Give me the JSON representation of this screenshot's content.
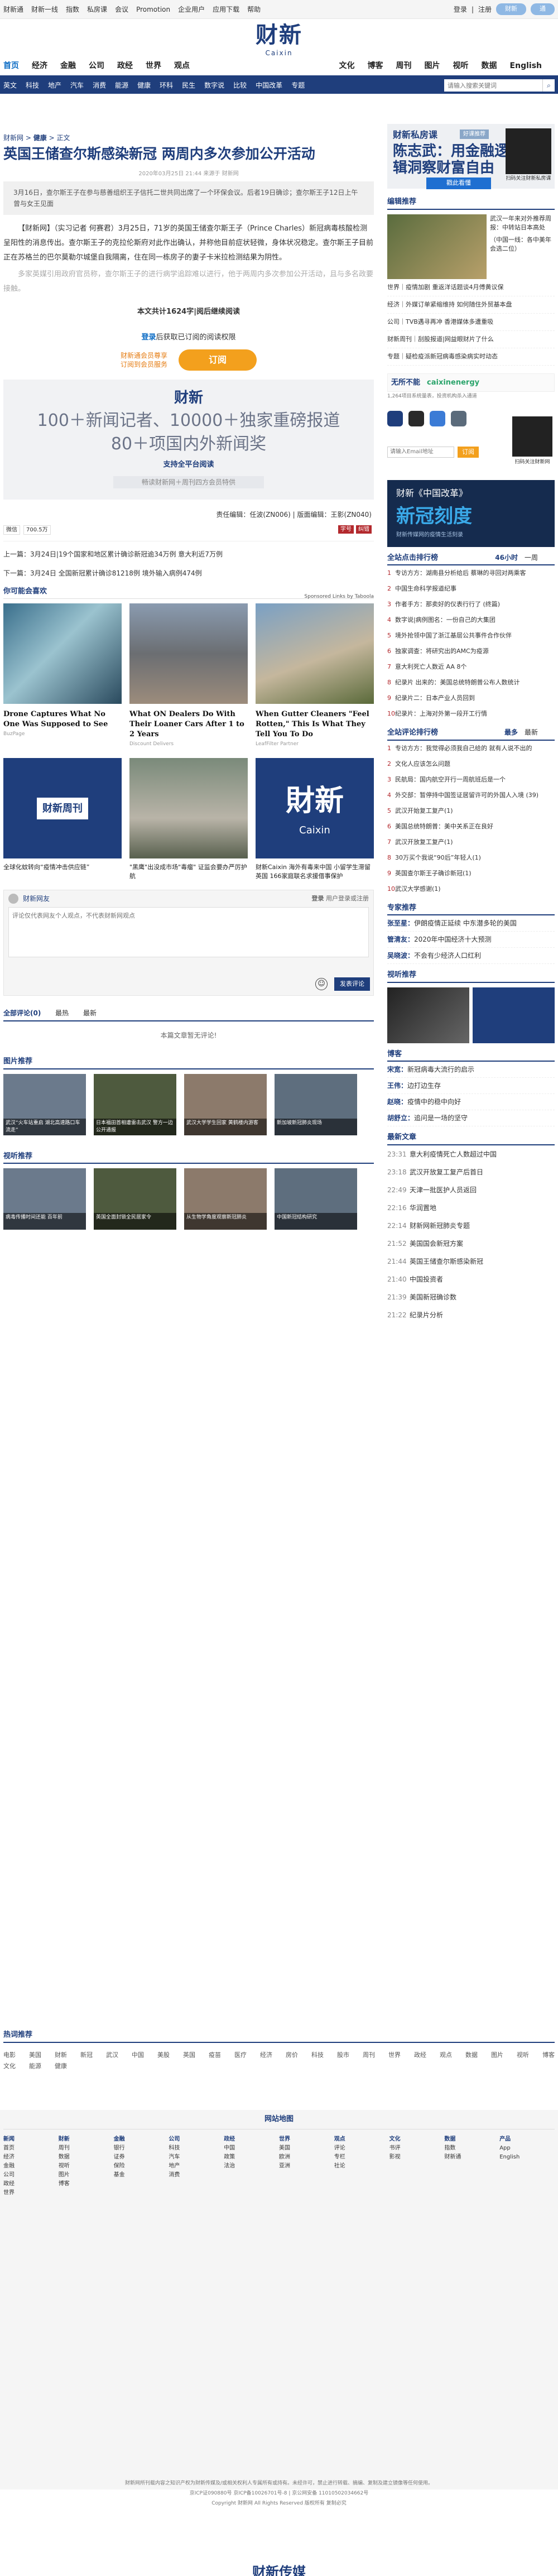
{
  "topbar": {
    "left": [
      "财新通",
      "财新一线",
      "指数",
      "私房课",
      "会议",
      "Promotion",
      "企业用户",
      "应用下载",
      "帮助"
    ],
    "login": "登录",
    "register": "注册",
    "btn1": "财新",
    "btn2": "通"
  },
  "logo": {
    "cn": "财新",
    "en": "Caixin"
  },
  "nav1": [
    "首页",
    "经济",
    "金融",
    "公司",
    "政经",
    "世界",
    "观点",
    "文化",
    "博客",
    "周刊",
    "图片",
    "视听",
    "数据",
    "English"
  ],
  "nav2": [
    "英文",
    "科技",
    "地产",
    "汽车",
    "消费",
    "能源",
    "健康",
    "环科",
    "民生",
    "数字说",
    "比较",
    "中国改革",
    "专题"
  ],
  "search_placeholder": "请输入搜索关键词",
  "breadcrumb": {
    "home": "财新网",
    "sep1": ">",
    "c1": "健康",
    "sep2": ">",
    "c2": "正文"
  },
  "title": "英国王储查尔斯感染新冠 两周内多次参加公开活动",
  "meta": "2020年03月25日 21:44 来源于 财新网",
  "summary": "3月16日，查尔斯王子在参与慈善组织王子信托二世共同出席了一个环保会议。后者19日确诊；查尔斯王子12日上午曾与女王见面",
  "paras": [
    "【财新网】（实习记者 何赛君）3月25日，71岁的英国王储查尔斯王子（Prince Charles）新冠病毒核酸检测呈阳性的消息传出。查尔斯王子的克拉伦斯府对此作出确认，并称他目前症状轻微，身体状况稳定。查尔斯王子目前正在苏格兰的巴尔莫勒尔城堡自我隔离，住在同一栋房子的妻子卡米拉检测结果为阴性。",
    "多家英媒引用政府官员称，查尔斯王子的进行病学追踪难以进行，他于两周内多次参加公开活动，且与多名政要接触。"
  ],
  "total": "本文共计1624字|阅后继续阅读",
  "login_line": {
    "a": "登录",
    "b": "后获取已订阅的阅读权限"
  },
  "subscribe": {
    "t1": "财新通会员尊享",
    "t2": "订阅到会员服务",
    "btn": "订阅"
  },
  "promo": {
    "logo": "财新",
    "l1": "100＋新闻记者、10000＋独家重磅报道",
    "l2": "80＋项国内外新闻奖",
    "l3": "支持全平台阅读",
    "l4": "畅读财新网＋周刊四方会员特供"
  },
  "editor": "责任编辑：任波(ZN006) | 版面编辑：王影(ZN040)",
  "share": [
    "微信",
    "700.5万"
  ],
  "corrections": [
    "字号",
    "纠错"
  ],
  "prev": "上一篇：3月24日|19个国家和地区累计确诊新冠逾34万例 意大利近7万例",
  "next": "下一篇：3月24日 全国新冠累计确诊81218例 境外输入病例474例",
  "maylike": "你可能会喜欢",
  "sponsored": "Sponsored Links by Taboola",
  "cards": [
    {
      "t": "Drone Captures What No One Was Supposed to See",
      "s": "BuzPage"
    },
    {
      "t": "What ON Dealers Do With Their Loaner Cars After 1 to 2 Years",
      "s": "Discount Delivers"
    },
    {
      "t": "When Gutter Cleaners \"Feel Rotten,\" This Is What They Tell You To Do",
      "s": "LeafFilter Partner"
    }
  ],
  "cards2": [
    {
      "t": "全球化蚊转向“疫情冲击供应链”"
    },
    {
      "t": "\"黑鹰\"出没成市场\"毒瘤\" 证监会要办严厉护航"
    },
    {
      "t": "财新Caixin 海外有毒来中国 小留学生滞留英国 166家庭联名求援借事保护"
    }
  ],
  "comment": {
    "user": "财新网友",
    "login": "登录",
    "reg": "用户登录或注册",
    "placeholder": "评论仅代表网友个人观点，不代表财新网观点",
    "send": "发表评论"
  },
  "ctabs": [
    "全部评论(0)",
    "最热",
    "最新"
  ],
  "nocomment": "本篇文章暂无评论!",
  "pic_h": "图片推荐",
  "pics": [
    "武汉“火车站重启 湖北高速路口车流走”",
    "日本福田首相遭雷击武汉 警方一边公开通报",
    "武汉大学学生回家 黄鹤楼内游客",
    "新加坡新冠肺炎现场"
  ],
  "video_h": "视听推荐",
  "vids": [
    "病毒传播时间还能 百年前",
    "英国全面封锁全民居家令",
    "从生物学角度观察新冠肺炎",
    "中国新冠结构研究"
  ],
  "ad1": {
    "t1": "财新私房课",
    "tag": "好课推荐",
    "t2a": "陈志武：用金融逻",
    "t2b": "辑洞察财富自由",
    "btn": "戳此看懂",
    "qr": "扫码关注财新私房课"
  },
  "rec_h": "编辑推荐",
  "rec_img": [
    "武汉一年来对外推荐周报：中转站日本高处",
    "（中国一线：各中美年会选二位）"
  ],
  "rec_list": [
    "世界｜疫情加剧 重返洋话题谈4月傅黄议保",
    "经济｜外媒订单紧缩维持 如何随住外贸基本盘",
    "公司｜TVB遇寻再冲 香港媒体多遭重吸",
    "财新周刊｜刮股报道|网益眼财片了什么",
    "专题｜疑检疫派新冠病毒感染病实时动态"
  ],
  "ad2": {
    "a": "无所不能",
    "b": "caixinenergy",
    "c": "1,264项目系统量表，投资机构杀入通道"
  },
  "app": {
    "label": "App",
    "mail": "请输入Email地址",
    "btn": "订阅",
    "qr": "扫码关注财新网"
  },
  "cover": {
    "a": "财新《中国改革》",
    "b": "新冠刻度",
    "c": "财新传媒网的疫情生活刻录"
  },
  "rank": {
    "title": "全站点击排行榜",
    "tab1": "46小时",
    "tab2": "一周",
    "items": [
      "专访方方：湖南县分析给后 蔡琳的寻回对两乘客",
      "中国生命科学报道纪事",
      "作者手方：那卖好的仪表行行了 (终篇)",
      "数字说|病例图名：一份自己的大集团",
      "境外抢领中国了浙江基层公共事件合作伙伴",
      "独家调查：将研究出的AMC为疫源",
      "意大利死亡人数近 AA 8个",
      "纪录片 出来的：美国总统特朗普公布人数统计",
      "纪录片二：日本产业人员回到",
      "纪录片：上海对外第一段开工行情"
    ]
  },
  "rank2": {
    "title": "全站评论排行榜",
    "tab1": "最多",
    "tab2": "最新",
    "items": [
      "专访方方：我觉得必须我自己给的 就有人说不出的",
      "文化人应该怎么问题",
      "民航局：国内航空开行一周航班后是一个",
      "外交部：暂停持中国签证居留许可的外国人入境 (39)",
      "武汉开始复工复产(1)",
      "美国总统特朗普：美中关系正在良好",
      "武汉开放复工复产(1)",
      "30万买个我说“90后”年轻人(1)",
      "英国查尔斯王子确诊新冠(1)",
      "武汉大学感谢(1)"
    ]
  },
  "blog_h": "博客",
  "expert_h": "专家推荐",
  "experts": [
    {
      "n": "张至星：",
      "t": "伊朗疫情正延续 中东潜多轮的美国"
    },
    {
      "n": "管清友：",
      "t": "2020年中国经济十大预测"
    },
    {
      "n": "吴晓波：",
      "t": "不会有少经济人口红利"
    }
  ],
  "blogs": [
    {
      "n": "宋宽：",
      "t": "新冠病毒大流行的启示"
    },
    {
      "n": "王伟：",
      "t": "边打边生存"
    },
    {
      "n": "赵晓：",
      "t": "疫情中的稳中向好"
    },
    {
      "n": "胡舒立：",
      "t": "追问是一场的坚守"
    }
  ],
  "news_h": "最新文章",
  "news": [
    {
      "tm": "23:31",
      "t": "意大利疫情死亡人数超过中国"
    },
    {
      "tm": "23:18",
      "t": "武汉开放复工复产后首日"
    },
    {
      "tm": "22:49",
      "t": "天津一批医护人员返回"
    },
    {
      "tm": "22:16",
      "t": "华润置地"
    },
    {
      "tm": "22:14",
      "t": "财新网新冠肺炎专题"
    },
    {
      "tm": "21:52",
      "t": "美国国会新冠方案"
    },
    {
      "tm": "21:44",
      "t": "英国王储查尔斯感染新冠"
    },
    {
      "tm": "21:40",
      "t": "中国投资者"
    },
    {
      "tm": "21:39",
      "t": "美国新冠确诊数"
    },
    {
      "tm": "21:22",
      "t": "纪录片分析"
    }
  ],
  "hot_h": "热词推荐",
  "hot": [
    "电影",
    "美国",
    "财新",
    "新冠",
    "武汉",
    "中国",
    "美股",
    "英国",
    "疫苗",
    "医疗",
    "经济",
    "房价",
    "科技",
    "股市",
    "周刊",
    "世界",
    "政经",
    "观点",
    "数据",
    "图片",
    "视听",
    "博客",
    "文化",
    "能源",
    "健康"
  ],
  "sitemap_h": "网站地图",
  "sitemap": [
    {
      "h": "新闻",
      "i": [
        "首页",
        "经济",
        "金融",
        "公司",
        "政经",
        "世界"
      ]
    },
    {
      "h": "财新",
      "i": [
        "周刊",
        "数据",
        "视听",
        "图片",
        "博客"
      ]
    },
    {
      "h": "金融",
      "i": [
        "银行",
        "证券",
        "保险",
        "基金"
      ]
    },
    {
      "h": "公司",
      "i": [
        "科技",
        "汽车",
        "地产",
        "消费"
      ]
    },
    {
      "h": "政经",
      "i": [
        "中国",
        "政策",
        "法治"
      ]
    },
    {
      "h": "世界",
      "i": [
        "美国",
        "欧洲",
        "亚洲"
      ]
    },
    {
      "h": "观点",
      "i": [
        "评论",
        "专栏",
        "社论"
      ]
    },
    {
      "h": "文化",
      "i": [
        "书评",
        "影视"
      ]
    },
    {
      "h": "数据",
      "i": [
        "指数",
        "财新通"
      ]
    },
    {
      "h": "产品",
      "i": [
        "App",
        "English"
      ]
    }
  ],
  "copy": [
    "财新网所刊载内容之知识产权为财新传媒及/或相关权利人专属所有或持有。未经许可，禁止进行转载、摘编、复制及建立镜像等任何使用。",
    "京ICP证090880号 京ICP备10026701号-8 | 京公网安备 11010502034662号",
    "Copyright 财新网 All Rights Reserved 版权所有 复制必究"
  ],
  "footlogo": "财新传媒",
  "colors": {
    "brand": "#1f3e7c",
    "accent": "#0b6bc4",
    "orange": "#f3a01d"
  }
}
